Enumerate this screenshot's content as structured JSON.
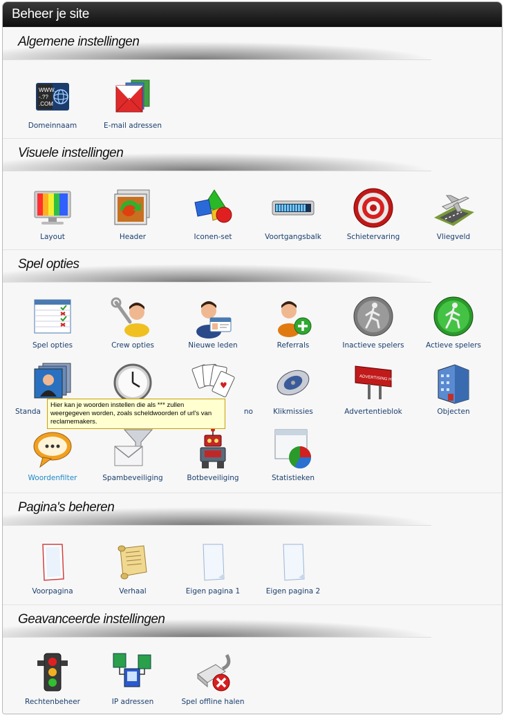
{
  "window": {
    "title": "Beheer je site"
  },
  "sections": [
    {
      "title": "Algemene instellingen",
      "items": [
        {
          "label": "Domeinnaam",
          "icon": "domain-icon"
        },
        {
          "label": "E-mail adressen",
          "icon": "email-icon"
        }
      ]
    },
    {
      "title": "Visuele instellingen",
      "items": [
        {
          "label": "Layout",
          "icon": "monitor-icon"
        },
        {
          "label": "Header",
          "icon": "header-image-icon"
        },
        {
          "label": "Iconen-set",
          "icon": "shapes-icon"
        },
        {
          "label": "Voortgangsbalk",
          "icon": "progress-bar-icon"
        },
        {
          "label": "Schietervaring",
          "icon": "target-icon"
        },
        {
          "label": "Vliegveld",
          "icon": "airplane-icon"
        }
      ]
    },
    {
      "title": "Spel opties",
      "items": [
        {
          "label": "Spel opties",
          "icon": "checklist-icon"
        },
        {
          "label": "Crew opties",
          "icon": "crew-wrench-icon"
        },
        {
          "label": "Nieuwe leden",
          "icon": "id-card-icon"
        },
        {
          "label": "Referrals",
          "icon": "add-user-icon"
        },
        {
          "label": "Inactieve spelers",
          "icon": "inactive-walker-icon"
        },
        {
          "label": "Actieve spelers",
          "icon": "active-walker-icon"
        },
        {
          "label": "Standa",
          "icon": "user-stack-icon"
        },
        {
          "label": "",
          "icon": "clock-icon"
        },
        {
          "label": "no",
          "icon": "playing-cards-icon"
        },
        {
          "label": "Klikmissies",
          "icon": "mouse-icon"
        },
        {
          "label": "Advertentieblok",
          "icon": "billboard-icon"
        },
        {
          "label": "Objecten",
          "icon": "building-icon"
        },
        {
          "label": "Woordenfilter",
          "icon": "speech-bubble-icon"
        },
        {
          "label": "Spambeveiliging",
          "icon": "mail-funnel-icon"
        },
        {
          "label": "Botbeveiliging",
          "icon": "robot-icon"
        },
        {
          "label": "Statistieken",
          "icon": "pie-chart-window-icon"
        }
      ]
    },
    {
      "title": "Pagina's beheren",
      "items": [
        {
          "label": "Voorpagina",
          "icon": "front-page-icon"
        },
        {
          "label": "Verhaal",
          "icon": "scroll-icon"
        },
        {
          "label": "Eigen pagina 1",
          "icon": "blank-page-icon"
        },
        {
          "label": "Eigen pagina 2",
          "icon": "blank-page-icon"
        }
      ]
    },
    {
      "title": "Geavanceerde instellingen",
      "items": [
        {
          "label": "Rechtenbeheer",
          "icon": "traffic-light-icon"
        },
        {
          "label": "IP adressen",
          "icon": "network-computers-icon"
        },
        {
          "label": "Spel offline halen",
          "icon": "network-cable-offline-icon"
        }
      ]
    }
  ],
  "tooltip": {
    "text": "Hier kan je woorden instellen die als *** zullen weergegeven worden, zoals scheldwoorden of url's van reclamemakers."
  }
}
